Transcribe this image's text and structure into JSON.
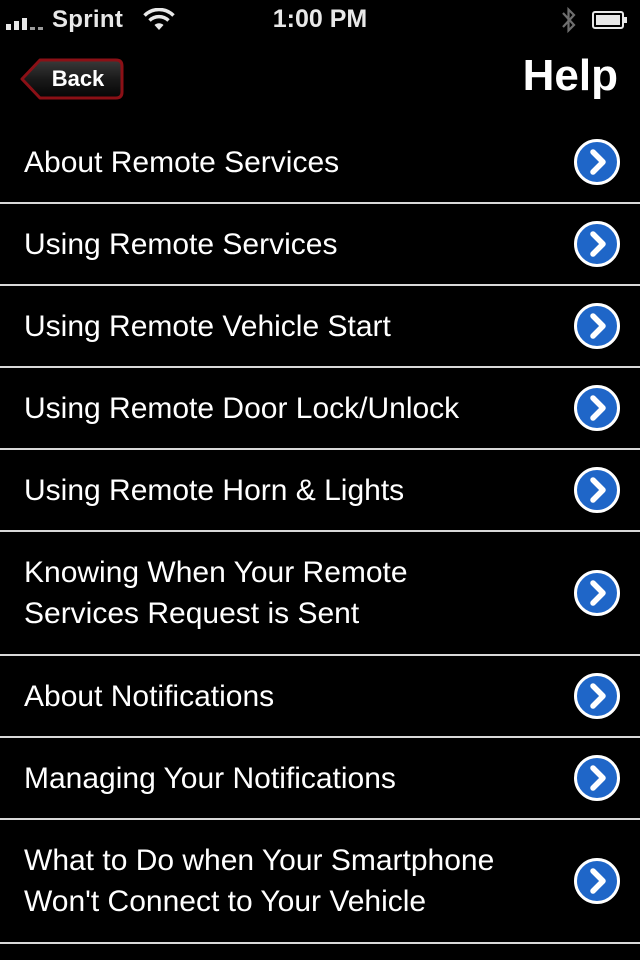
{
  "status_bar": {
    "carrier": "Sprint",
    "time": "1:00 PM",
    "icons": [
      "signal-bars-icon",
      "wifi-icon",
      "bluetooth-icon",
      "battery-icon"
    ]
  },
  "nav_bar": {
    "back_label": "Back",
    "title": "Help",
    "back_border_color": "#8b1016"
  },
  "help_items": [
    {
      "label": "About Remote Services"
    },
    {
      "label": "Using Remote Services"
    },
    {
      "label": "Using Remote Vehicle Start"
    },
    {
      "label": "Using Remote Door Lock/Unlock"
    },
    {
      "label": "Using Remote Horn & Lights"
    },
    {
      "label": "Knowing When Your Remote\nServices Request is Sent"
    },
    {
      "label": "About Notifications"
    },
    {
      "label": "Managing Your Notifications"
    },
    {
      "label": "What to Do when Your Smartphone\nWon't Connect to Your Vehicle"
    }
  ],
  "colors": {
    "background": "#000000",
    "separator": "#d9d9d9",
    "disclosure_blue": "#1f66c8"
  }
}
